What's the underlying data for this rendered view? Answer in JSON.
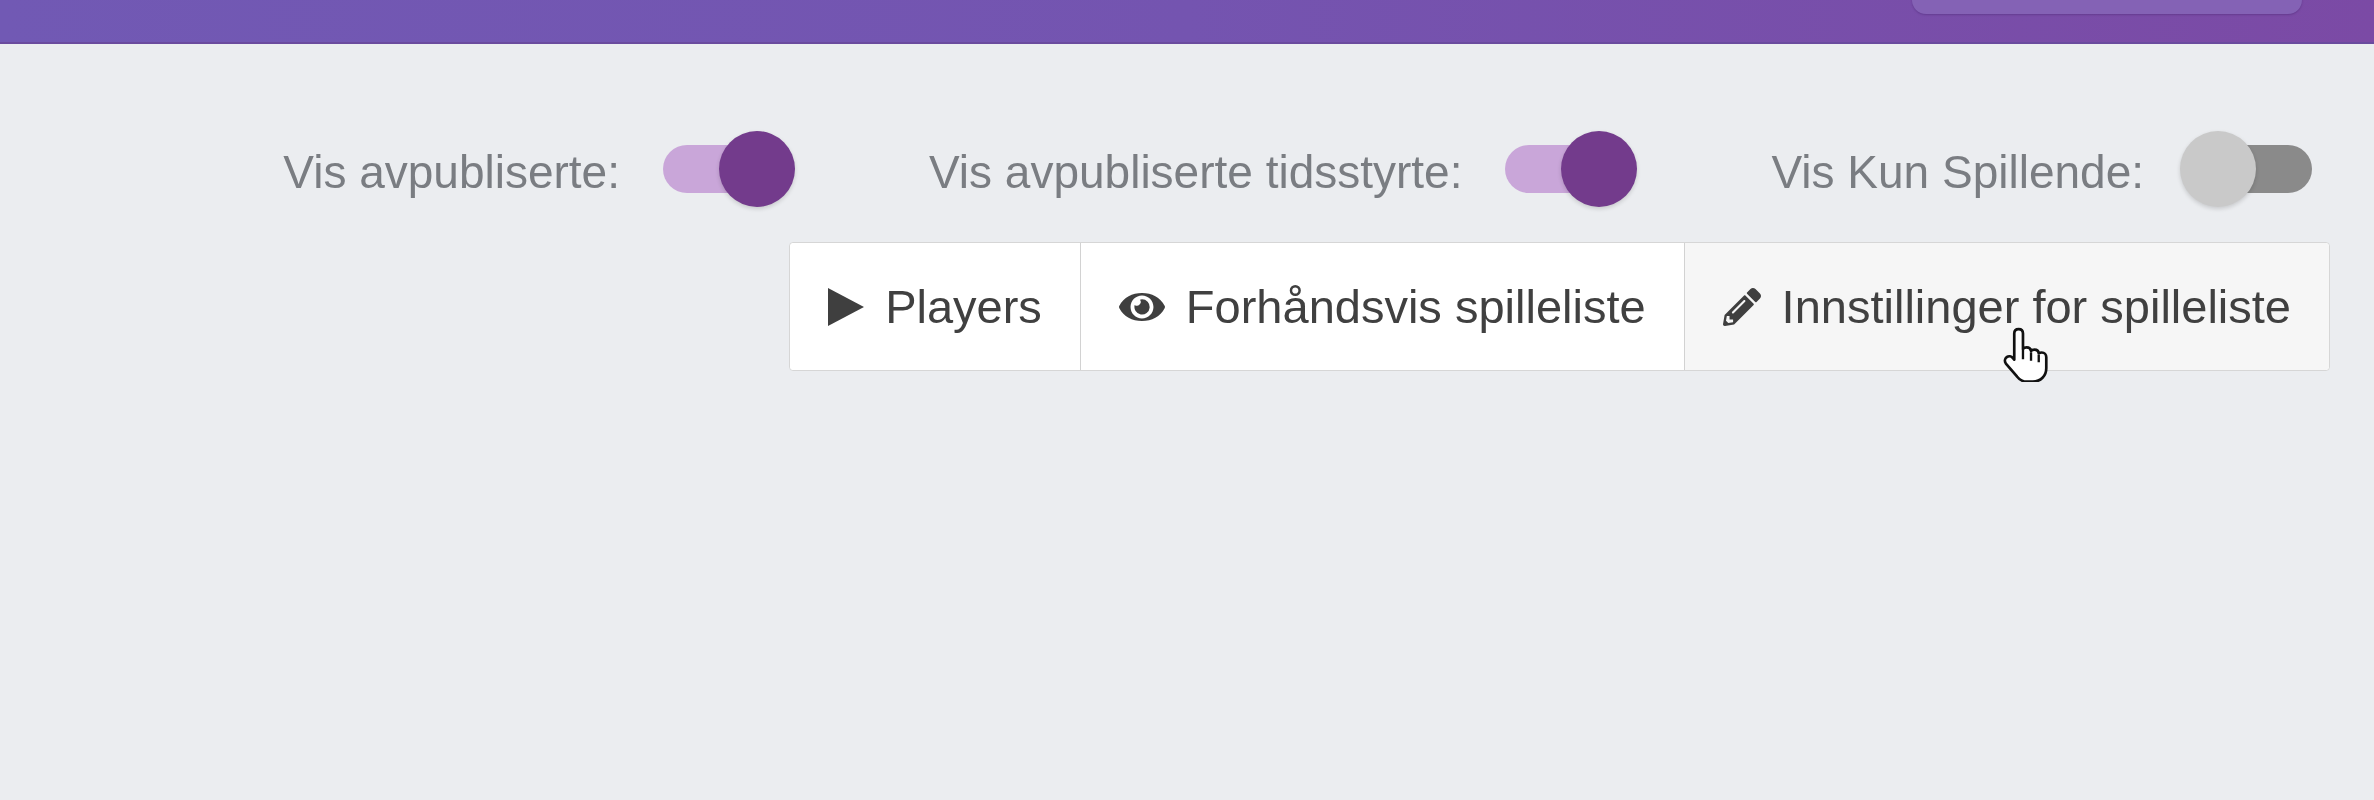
{
  "toggles": [
    {
      "label": "Vis avpubliserte:",
      "on": true
    },
    {
      "label": "Vis avpubliserte tidsstyrte:",
      "on": true
    },
    {
      "label": "Vis Kun Spillende:",
      "on": false
    }
  ],
  "buttons": [
    {
      "kind": "play",
      "label": "Players",
      "hovered": false
    },
    {
      "kind": "eye",
      "label": "Forhåndsvis spilleliste",
      "hovered": false
    },
    {
      "kind": "pencil",
      "label": "Innstillinger for spilleliste",
      "hovered": true
    }
  ]
}
